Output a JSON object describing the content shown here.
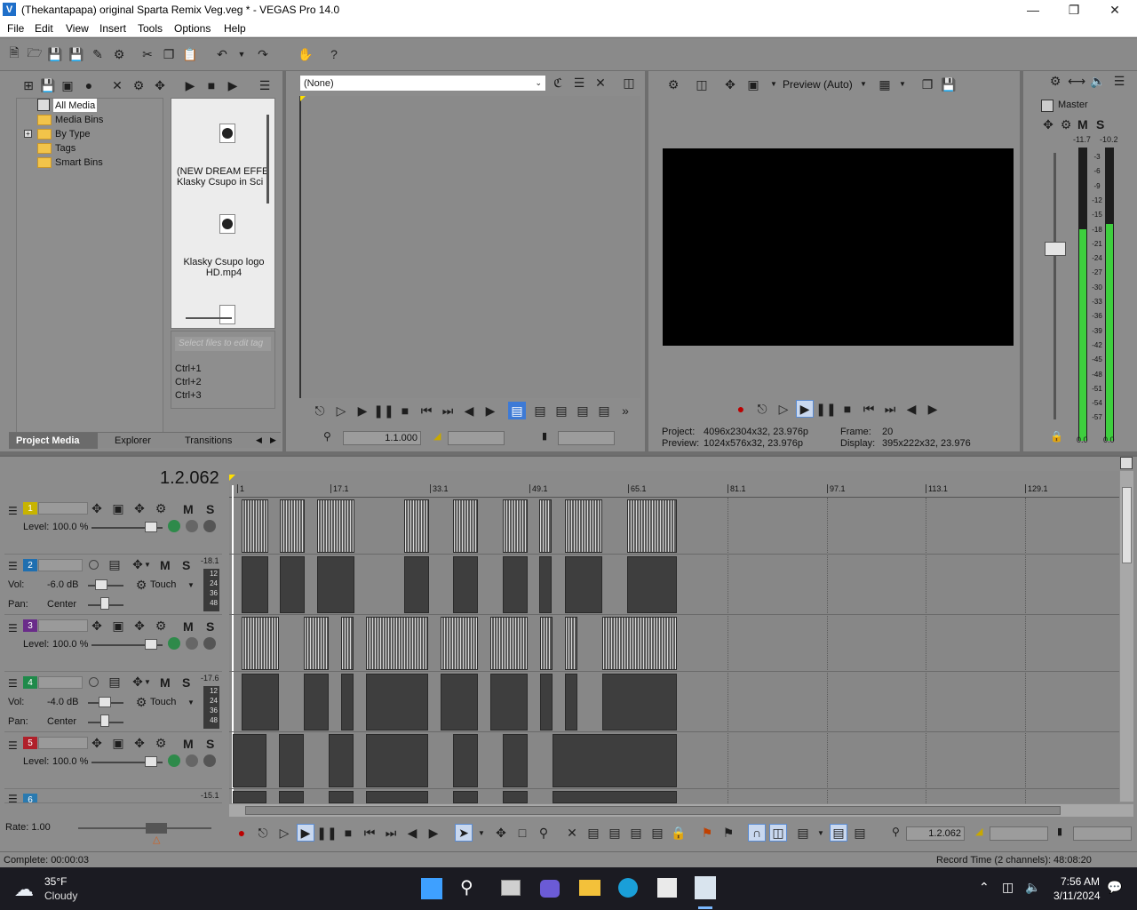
{
  "window": {
    "title": "(Thekantapapa) original Sparta Remix Veg.veg * - VEGAS Pro 14.0",
    "app_icon": "vegas-icon"
  },
  "menu": [
    "File",
    "Edit",
    "View",
    "Insert",
    "Tools",
    "Options",
    "Help"
  ],
  "project_media": {
    "tree": [
      "All Media",
      "Media Bins",
      "By Type",
      "Tags",
      "Smart Bins"
    ],
    "files": [
      {
        "name_line1": "(NEW DREAM EFFE",
        "name_line2": "Klasky Csupo in Sci"
      },
      {
        "name_line1": "Klasky Csupo logo",
        "name_line2": "HD.mp4"
      }
    ],
    "tag_placeholder": "Select files to edit tag",
    "shortcuts": [
      "Ctrl+1",
      "Ctrl+2",
      "Ctrl+3"
    ],
    "tabs": [
      "Project Media",
      "Explorer",
      "Transitions"
    ]
  },
  "trimmer": {
    "dropdown": "(None)",
    "timecode": "1.1.000"
  },
  "preview": {
    "mode": "Preview (Auto)",
    "project_label": "Project:",
    "project_value": "4096x2304x32, 23.976p",
    "preview_label": "Preview:",
    "preview_value": "1024x576x32, 23.976p",
    "frame_label": "Frame:",
    "frame_value": "20",
    "display_label": "Display:",
    "display_value": "395x222x32, 23.976"
  },
  "master": {
    "label": "Master",
    "peak_left": "-11.7",
    "peak_right": "-10.2",
    "scale": [
      "3",
      "6",
      "9",
      "12",
      "15",
      "18",
      "21",
      "24",
      "27",
      "30",
      "33",
      "36",
      "39",
      "42",
      "45",
      "48",
      "51",
      "54",
      "57"
    ],
    "out_left": "0.0",
    "out_right": "0.0",
    "mute": "M",
    "solo": "S"
  },
  "timeline": {
    "cursor_time": "1.2.062",
    "ruler": [
      "1",
      "17.1",
      "33.1",
      "49.1",
      "65.1",
      "81.1",
      "97.1",
      "113.1",
      "129.1"
    ],
    "tracks": [
      {
        "num": "1",
        "type": "video",
        "color": "#c8b400",
        "level_label": "Level:",
        "level": "100.0 %"
      },
      {
        "num": "2",
        "type": "audio",
        "color": "#1f6fb0",
        "vol_label": "Vol:",
        "vol": "-6.0 dB",
        "pan_label": "Pan:",
        "pan": "Center",
        "mode": "Touch",
        "peak": "-18.1",
        "meter_scale": [
          "12",
          "24",
          "36",
          "48"
        ]
      },
      {
        "num": "3",
        "type": "video",
        "color": "#6a2c8a",
        "level_label": "Level:",
        "level": "100.0 %"
      },
      {
        "num": "4",
        "type": "audio",
        "color": "#1f8a4a",
        "vol_label": "Vol:",
        "vol": "-4.0 dB",
        "pan_label": "Pan:",
        "pan": "Center",
        "mode": "Touch",
        "peak": "-17.6",
        "meter_scale": [
          "12",
          "24",
          "36",
          "48"
        ]
      },
      {
        "num": "5",
        "type": "video",
        "color": "#b0202a",
        "level_label": "Level:",
        "level": "100.0 %"
      },
      {
        "num": "6",
        "type": "audio",
        "color": "#2a7ab0",
        "peak": "-15.1"
      }
    ],
    "rate_label": "Rate: 1.00",
    "bottom_timecode": "1.2.062"
  },
  "status": {
    "complete": "Complete: 00:00:03",
    "record_time": "Record Time (2 channels): 48:08:20"
  },
  "taskbar": {
    "temp": "35°F",
    "weather": "Cloudy",
    "time": "7:56 AM",
    "date": "3/11/2024"
  }
}
